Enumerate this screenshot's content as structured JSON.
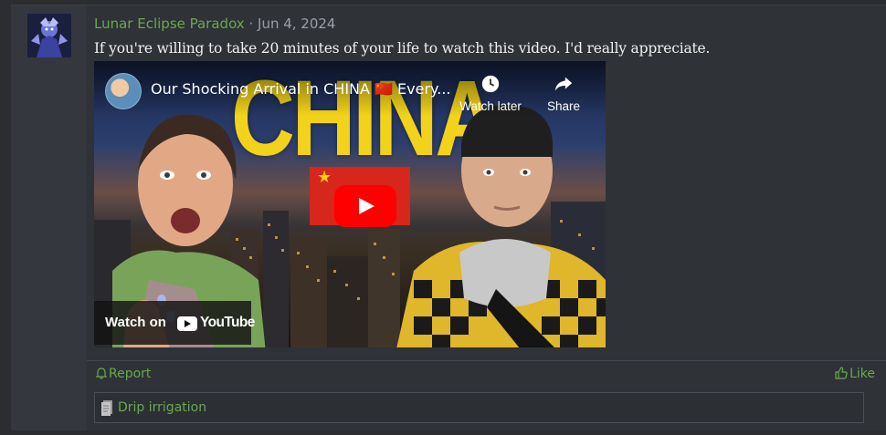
{
  "post": {
    "author": "Lunar Eclipse Paradox",
    "separator": "·",
    "date": "Jun 4, 2024",
    "message": "If you're willing to take 20 minutes of your life to watch this video. I'd really appreciate."
  },
  "video": {
    "title": "Our Shocking Arrival in CHINA 🇨🇳 Every...",
    "thumbnail_text": "CHINA",
    "watch_later_label": "Watch later",
    "share_label": "Share",
    "watch_on_label": "Watch on",
    "youtube_label": "YouTube"
  },
  "actions": {
    "report_label": "Report",
    "like_label": "Like"
  },
  "signature": {
    "text": "Drip irrigation"
  },
  "colors": {
    "accent": "#6aa84f",
    "background": "#2f3237",
    "youtube_red": "#ff0000",
    "thumbnail_yellow": "#f2d21a"
  }
}
